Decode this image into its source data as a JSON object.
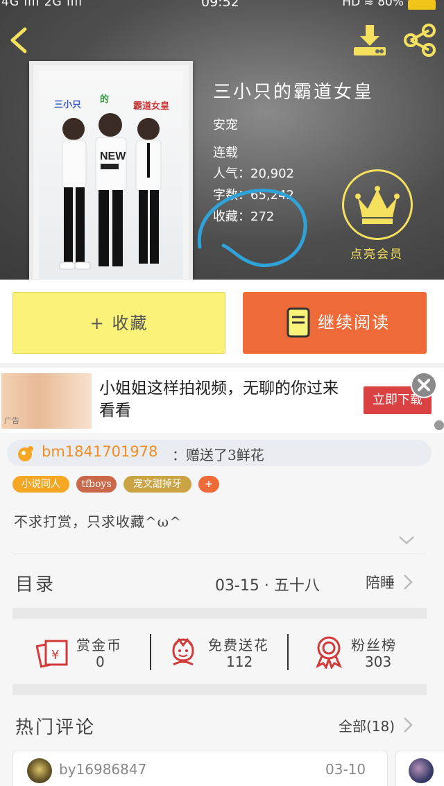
{
  "status_bar": {
    "network": "4G ııll 2G ııll",
    "time": "09:52",
    "right": "HD ≋ 80%"
  },
  "book": {
    "title": "三小只的霸道女皇",
    "category": "安宠",
    "status": "连载",
    "popularity": "人气：20,902",
    "word_count": "字数：65,242",
    "favorites": "收藏：272",
    "cover_text_1": "三小只",
    "cover_text_2": "的",
    "cover_text_3": "霸道女皇",
    "vip_label": "点亮会员"
  },
  "actions": {
    "collect_label": "+ 收藏",
    "read_label": "继续阅读"
  },
  "ad": {
    "text": "小姐姐这样拍视频，无聊的你过来看看",
    "cta": "立即下载",
    "thumb_tag": "广告"
  },
  "gift": {
    "user": "bm1841701978",
    "text": "：赠送了3鲜花"
  },
  "tags": [
    {
      "label": "小说同人",
      "color": "#f5a623"
    },
    {
      "label": "tfboys",
      "color": "#c9694a"
    },
    {
      "label": "宠文甜掉牙",
      "color": "#caa443"
    },
    {
      "label": "+",
      "color": "#ef6a39"
    }
  ],
  "description": "不求打赏，只求收藏^ω^",
  "toc": {
    "label": "目录",
    "date": "03-15 ·",
    "chapter_num": "五十八",
    "chapter": "陪睡"
  },
  "stats": [
    {
      "label": "赏金币",
      "value": "0",
      "icon": "red-envelope-icon"
    },
    {
      "label": "免费送花",
      "value": "112",
      "icon": "flower-icon"
    },
    {
      "label": "粉丝榜",
      "value": "303",
      "icon": "medal-icon"
    }
  ],
  "comments": {
    "label": "热门评论",
    "all": "全部(18)",
    "items": [
      {
        "user": "by16986847",
        "date": "03-10"
      }
    ]
  },
  "colors": {
    "accent_orange": "#ef6a39",
    "collect_yellow": "#fbf279",
    "vip_gold": "#f6e15e",
    "annotation_blue": "#2fa3d8"
  }
}
